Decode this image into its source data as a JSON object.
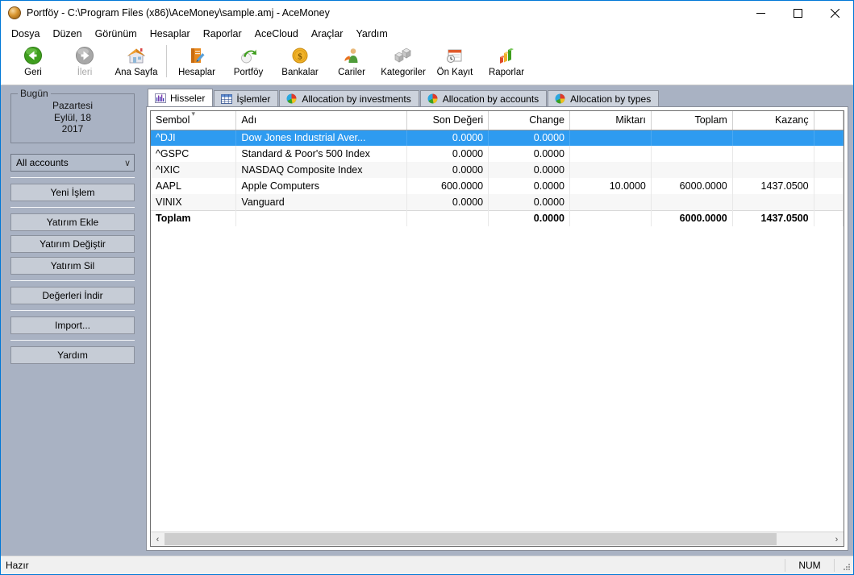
{
  "window": {
    "title": "Portföy - C:\\Program Files (x86)\\AceMoney\\sample.amj - AceMoney",
    "app_icon": "acemoney-coin-icon",
    "minimize": "–",
    "maximize": "☐",
    "close": "✕"
  },
  "menubar": {
    "items": [
      {
        "label": "Dosya"
      },
      {
        "label": "Düzen"
      },
      {
        "label": "Görünüm"
      },
      {
        "label": "Hesaplar"
      },
      {
        "label": "Raporlar"
      },
      {
        "label": "AceCloud"
      },
      {
        "label": "Araçlar"
      },
      {
        "label": "Yardım"
      }
    ]
  },
  "toolbar": {
    "items": [
      {
        "label": "Geri",
        "icon": "back-arrow-icon",
        "enabled": true
      },
      {
        "label": "İleri",
        "icon": "forward-arrow-icon",
        "enabled": false
      },
      {
        "label": "Ana Sayfa",
        "icon": "home-house-icon",
        "enabled": true
      },
      {
        "label": "Hesaplar",
        "icon": "book-pen-icon",
        "enabled": true
      },
      {
        "label": "Portföy",
        "icon": "portfolio-arrow-icon",
        "enabled": true
      },
      {
        "label": "Bankalar",
        "icon": "dollar-coin-icon",
        "enabled": true
      },
      {
        "label": "Cariler",
        "icon": "person-icon",
        "enabled": true
      },
      {
        "label": "Kategoriler",
        "icon": "cubes-icon",
        "enabled": true
      },
      {
        "label": "Ön Kayıt",
        "icon": "calendar-clock-icon",
        "enabled": true
      },
      {
        "label": "Raporlar",
        "icon": "bar-chart-icon",
        "enabled": true
      }
    ]
  },
  "sidebar": {
    "today_group_title": "Bugün",
    "today": {
      "weekday": "Pazartesi",
      "date": "Eylül, 18",
      "year": "2017"
    },
    "account_filter": {
      "value": "All accounts",
      "chevron": "∨"
    },
    "buttons": [
      {
        "label": "Yeni İşlem"
      },
      {
        "label": "Yatırım Ekle"
      },
      {
        "label": "Yatırım Değiştir"
      },
      {
        "label": "Yatırım Sil"
      },
      {
        "label": "Değerleri İndir"
      },
      {
        "label": "Import..."
      },
      {
        "label": "Yardım"
      }
    ]
  },
  "tabs": [
    {
      "label": "Hisseler",
      "icon": "bars-chart-icon",
      "active": true
    },
    {
      "label": "İşlemler",
      "icon": "table-grid-icon",
      "active": false
    },
    {
      "label": "Allocation by investments",
      "icon": "pie-chart-icon",
      "active": false
    },
    {
      "label": "Allocation by accounts",
      "icon": "pie-chart-icon",
      "active": false
    },
    {
      "label": "Allocation by types",
      "icon": "pie-chart-icon",
      "active": false
    }
  ],
  "grid": {
    "columns": [
      {
        "label": "Sembol",
        "align": "left",
        "sorted": true
      },
      {
        "label": "Adı",
        "align": "left",
        "sorted": false
      },
      {
        "label": "Son Değeri",
        "align": "right",
        "sorted": false
      },
      {
        "label": "Change",
        "align": "right",
        "sorted": false
      },
      {
        "label": "Miktarı",
        "align": "right",
        "sorted": false
      },
      {
        "label": "Toplam",
        "align": "right",
        "sorted": false
      },
      {
        "label": "Kazanç",
        "align": "right",
        "sorted": false
      },
      {
        "label": "",
        "align": "right",
        "sorted": false
      }
    ],
    "rows": [
      {
        "selected": true,
        "symbol": "^DJI",
        "name": "Dow Jones Industrial Aver...",
        "last_value": "0.0000",
        "change": "0.0000",
        "quantity": "",
        "total": "",
        "gain": "",
        "extra": ""
      },
      {
        "selected": false,
        "symbol": "^GSPC",
        "name": "Standard & Poor's 500 Index",
        "last_value": "0.0000",
        "change": "0.0000",
        "quantity": "",
        "total": "",
        "gain": "",
        "extra": ""
      },
      {
        "selected": false,
        "symbol": "^IXIC",
        "name": "NASDAQ Composite Index",
        "last_value": "0.0000",
        "change": "0.0000",
        "quantity": "",
        "total": "",
        "gain": "",
        "extra": ""
      },
      {
        "selected": false,
        "symbol": "AAPL",
        "name": "Apple Computers",
        "last_value": "600.0000",
        "change": "0.0000",
        "quantity": "10.0000",
        "total": "6000.0000",
        "gain": "1437.0500",
        "extra": ""
      },
      {
        "selected": false,
        "symbol": "VINIX",
        "name": "Vanguard",
        "last_value": "0.0000",
        "change": "0.0000",
        "quantity": "",
        "total": "",
        "gain": "",
        "extra": ""
      }
    ],
    "total_row": {
      "symbol": "Toplam",
      "name": "",
      "last_value": "",
      "change": "0.0000",
      "quantity": "",
      "total": "6000.0000",
      "gain": "1437.0500",
      "extra": ""
    },
    "hscroll": {
      "left_arrow": "‹",
      "right_arrow": "›"
    }
  },
  "statusbar": {
    "message": "Hazır",
    "num_lock": "NUM"
  },
  "colors": {
    "selection_blue": "#2e9bf0",
    "sidebar_bg": "#a9b2c3",
    "window_border": "#0078d7",
    "accent_green": "#4aa521",
    "accent_orange": "#e08214"
  }
}
